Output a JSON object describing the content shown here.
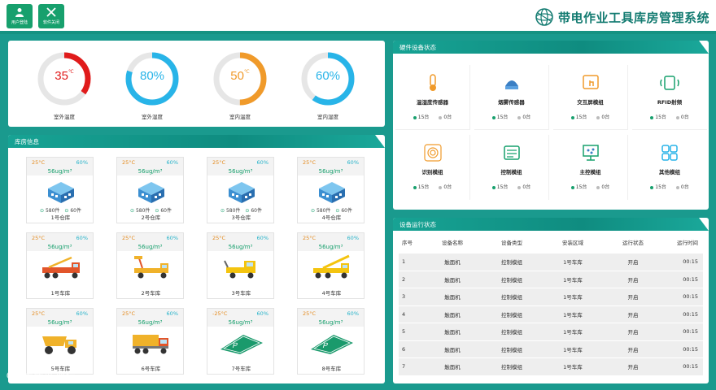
{
  "header": {
    "buttons": [
      {
        "label": "用户登陆",
        "icon": "user-icon"
      },
      {
        "label": "软件关闭",
        "icon": "close-icon"
      }
    ],
    "title": "带电作业工具库房管理系统",
    "logo": "grid-logo"
  },
  "gauges": [
    {
      "value": "35",
      "unit": "℃",
      "caption": "室外温度",
      "percent": 0.35,
      "color": "#e01b1b"
    },
    {
      "value": "80%",
      "unit": "",
      "caption": "室外湿度",
      "percent": 0.8,
      "color": "#28b4e8"
    },
    {
      "value": "50",
      "unit": "℃",
      "caption": "室内温度",
      "percent": 0.5,
      "color": "#f09a2a"
    },
    {
      "value": "60%",
      "unit": "",
      "caption": "室内湿度",
      "percent": 0.6,
      "color": "#28b4e8"
    }
  ],
  "warehouse": {
    "title": "库房信息",
    "cards": [
      {
        "temp": "25°C",
        "hum": "60%",
        "pm": "56ug/m³",
        "name": "1号仓库",
        "kind": "building",
        "count1": "580件",
        "count2": "60件"
      },
      {
        "temp": "25°C",
        "hum": "60%",
        "pm": "56ug/m³",
        "name": "2号仓库",
        "kind": "building",
        "count1": "580件",
        "count2": "60件"
      },
      {
        "temp": "25°C",
        "hum": "60%",
        "pm": "56ug/m³",
        "name": "3号仓库",
        "kind": "building",
        "count1": "580件",
        "count2": "60件"
      },
      {
        "temp": "25°C",
        "hum": "60%",
        "pm": "56ug/m³",
        "name": "4号仓库",
        "kind": "building",
        "count1": "580件",
        "count2": "60件"
      },
      {
        "temp": "25°C",
        "hum": "60%",
        "pm": "56ug/m³",
        "name": "1号车库",
        "kind": "crane-truck"
      },
      {
        "temp": "25°C",
        "hum": "60%",
        "pm": "56ug/m³",
        "name": "2号车库",
        "kind": "lift-truck"
      },
      {
        "temp": "25°C",
        "hum": "60%",
        "pm": "56ug/m³",
        "name": "3号车库",
        "kind": "tow-truck"
      },
      {
        "temp": "25°C",
        "hum": "60%",
        "pm": "56ug/m³",
        "name": "4号车库",
        "kind": "yellow-crane"
      },
      {
        "temp": "25°C",
        "hum": "60%",
        "pm": "56ug/m³",
        "name": "5号车库",
        "kind": "dumper"
      },
      {
        "temp": "25°C",
        "hum": "60%",
        "pm": "56ug/m³",
        "name": "6号车库",
        "kind": "dump-truck"
      },
      {
        "temp": "-25°C",
        "hum": "60%",
        "pm": "56ug/m³",
        "name": "7号车库",
        "kind": "parking"
      },
      {
        "temp": "25°C",
        "hum": "60%",
        "pm": "56ug/m³",
        "name": "8号车库",
        "kind": "parking"
      }
    ]
  },
  "hardware": {
    "title": "硬件设备状态",
    "devices": [
      {
        "name": "温湿度传感器",
        "icon": "thermometer-icon",
        "on": "15台",
        "off": "0台"
      },
      {
        "name": "烟雾传感器",
        "icon": "smoke-sensor-icon",
        "on": "15台",
        "off": "0台"
      },
      {
        "name": "交互屏模组",
        "icon": "touch-screen-icon",
        "on": "15台",
        "off": "0台"
      },
      {
        "name": "RFID射频",
        "icon": "rfid-icon",
        "on": "15台",
        "off": "0台"
      },
      {
        "name": "识别模组",
        "icon": "fingerprint-icon",
        "on": "15台",
        "off": "0台"
      },
      {
        "name": "控制模组",
        "icon": "control-module-icon",
        "on": "15台",
        "off": "0台"
      },
      {
        "name": "主控模组",
        "icon": "main-control-icon",
        "on": "15台",
        "off": "0台"
      },
      {
        "name": "其他模组",
        "icon": "other-modules-icon",
        "on": "15台",
        "off": "0台"
      }
    ]
  },
  "runtime": {
    "title": "设备运行状态",
    "columns": [
      "序号",
      "设备名称",
      "设备类型",
      "安装区域",
      "运行状态",
      "运行时间"
    ],
    "rows": [
      [
        "1",
        "触面机",
        "控制模组",
        "1号车库",
        "开启",
        "00:15"
      ],
      [
        "2",
        "触面机",
        "控制模组",
        "1号车库",
        "开启",
        "00:15"
      ],
      [
        "3",
        "触面机",
        "控制模组",
        "1号车库",
        "开启",
        "00:15"
      ],
      [
        "4",
        "触面机",
        "控制模组",
        "1号车库",
        "开启",
        "00:15"
      ],
      [
        "5",
        "触面机",
        "控制模组",
        "1号车库",
        "开启",
        "00:15"
      ],
      [
        "6",
        "触面机",
        "控制模组",
        "1号车库",
        "开启",
        "00:15"
      ],
      [
        "7",
        "触面机",
        "控制模组",
        "1号车库",
        "开启",
        "00:15"
      ]
    ]
  },
  "watermark": "大数据视镜"
}
